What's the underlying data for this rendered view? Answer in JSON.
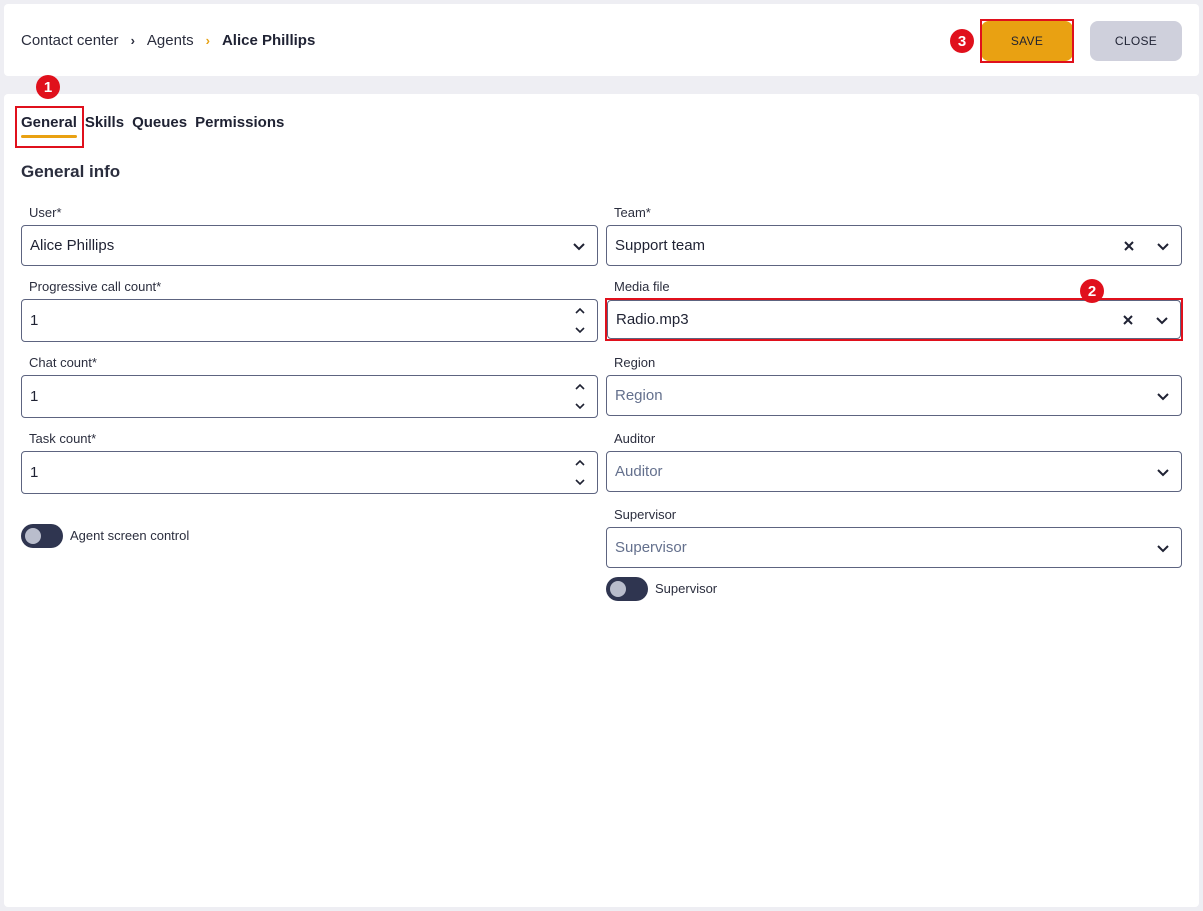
{
  "breadcrumb": {
    "root": "Contact center",
    "parent": "Agents",
    "current": "Alice Phillips"
  },
  "toolbar": {
    "save_label": "SAVE",
    "close_label": "CLOSE"
  },
  "callouts": {
    "one": "1",
    "two": "2",
    "three": "3"
  },
  "tabs": [
    {
      "label": "General",
      "active": true
    },
    {
      "label": "Skills"
    },
    {
      "label": "Queues"
    },
    {
      "label": "Permissions"
    }
  ],
  "section_title": "General info",
  "form": {
    "user": {
      "label": "User*",
      "value": "Alice Phillips"
    },
    "progressive_call_count": {
      "label": "Progressive call count*",
      "value": "1"
    },
    "chat_count": {
      "label": "Chat count*",
      "value": "1"
    },
    "task_count": {
      "label": "Task count*",
      "value": "1"
    },
    "agent_screen_control": {
      "label": "Agent screen control",
      "on": false
    },
    "team": {
      "label": "Team*",
      "value": "Support team"
    },
    "media_file": {
      "label": "Media file",
      "value": "Radio.mp3"
    },
    "region": {
      "label": "Region",
      "placeholder": "Region"
    },
    "auditor": {
      "label": "Auditor",
      "placeholder": "Auditor"
    },
    "supervisor": {
      "label": "Supervisor",
      "placeholder": "Supervisor"
    },
    "supervisor_toggle": {
      "label": "Supervisor",
      "on": false
    }
  },
  "colors": {
    "accent": "#e9a112",
    "highlight": "#e0101c",
    "close_button": "#cfd0dc",
    "toggle_off": "#2f3550"
  },
  "icons": [
    "chevron-right-icon",
    "chevron-down-icon",
    "close-icon",
    "chevron-up-icon"
  ]
}
